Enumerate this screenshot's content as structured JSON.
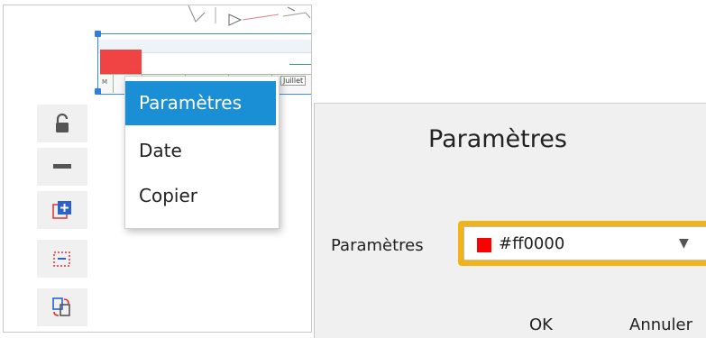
{
  "context_menu": {
    "items": [
      "Paramètres",
      "Date",
      "Copier"
    ],
    "active_index": 0
  },
  "timeline": {
    "month_label": "Juillet",
    "cell_prefix": "M"
  },
  "toolbar": {
    "buttons": [
      {
        "icon": "lock-icon"
      },
      {
        "icon": "minus-icon"
      },
      {
        "icon": "add-block-icon"
      },
      {
        "icon": "remove-block-icon"
      },
      {
        "icon": "copy-swap-icon"
      }
    ]
  },
  "dialog": {
    "title": "Paramètres",
    "field_label": "Paramètres",
    "select_value": "#ff0000",
    "swatch_color": "#ff0000",
    "ok_label": "OK",
    "cancel_label": "Annuler"
  },
  "colors": {
    "menu_highlight": "#1a8fd6",
    "focus_border": "#f2b318",
    "selection_blue": "#2f7fe0"
  }
}
